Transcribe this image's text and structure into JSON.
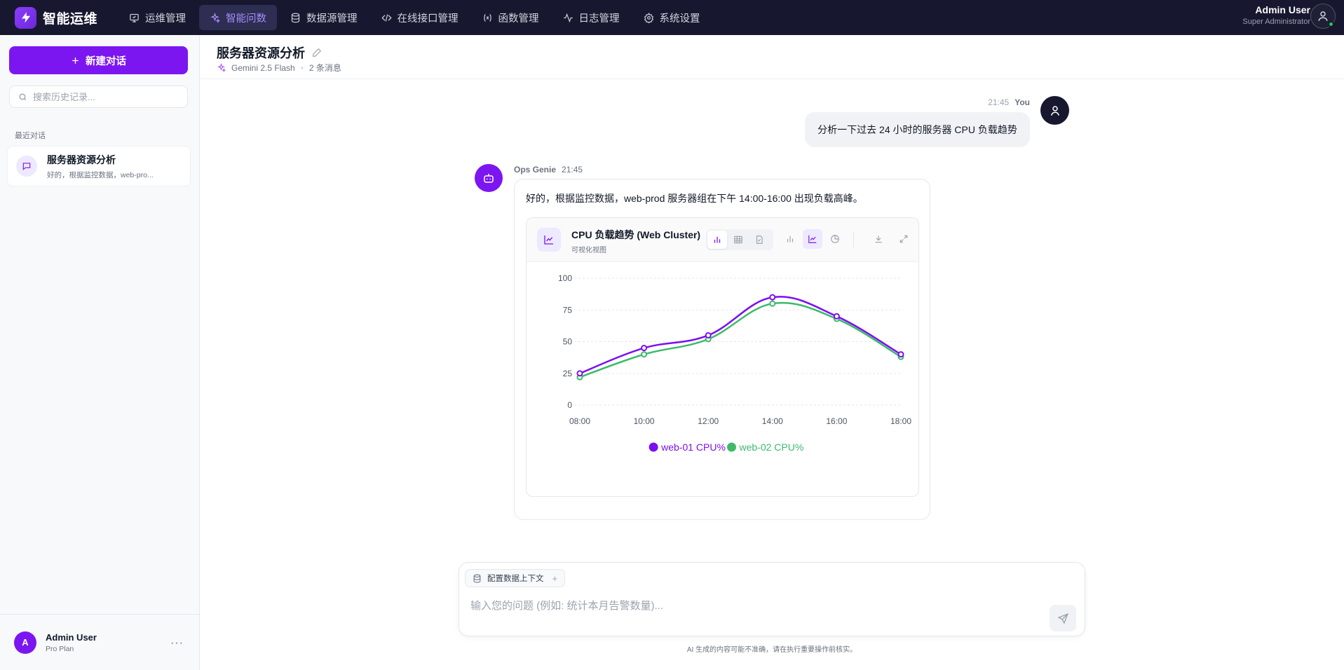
{
  "app": {
    "brand": "智能运维"
  },
  "nav": {
    "items": [
      {
        "label": "运维管理",
        "icon": "monitor-icon"
      },
      {
        "label": "智能问数",
        "icon": "sparkle-icon",
        "active": true
      },
      {
        "label": "数据源管理",
        "icon": "database-icon"
      },
      {
        "label": "在线接口管理",
        "icon": "code-icon"
      },
      {
        "label": "函数管理",
        "icon": "function-icon"
      },
      {
        "label": "日志管理",
        "icon": "activity-icon"
      },
      {
        "label": "系统设置",
        "icon": "gear-icon"
      }
    ]
  },
  "user": {
    "name": "Admin User",
    "role": "Super Administrator",
    "initial": "A",
    "plan": "Pro Plan"
  },
  "sidebar": {
    "new_chat": "新建对话",
    "search_placeholder": "搜索历史记录...",
    "section_label": "最近对话",
    "conversations": [
      {
        "title": "服务器资源分析",
        "preview": "好的，根据监控数据，web-pro..."
      }
    ]
  },
  "conversation": {
    "title": "服务器资源分析",
    "model": "Gemini 2.5 Flash",
    "message_count": "2 条消息"
  },
  "messages": {
    "user": {
      "time": "21:45",
      "sender": "You",
      "text": "分析一下过去 24 小时的服务器 CPU 负载趋势"
    },
    "bot": {
      "sender": "Ops Genie",
      "time": "21:45",
      "text": "好的，根据监控数据，web-prod 服务器组在下午 14:00-16:00 出现负载高峰。",
      "chart_title": "CPU 负载趋势 (Web Cluster)",
      "chart_subtitle": "可视化视图"
    }
  },
  "chart_data": {
    "type": "line",
    "categories": [
      "08:00",
      "10:00",
      "12:00",
      "14:00",
      "16:00",
      "18:00"
    ],
    "ylim": [
      0,
      100
    ],
    "yticks": [
      0,
      25,
      50,
      75,
      100
    ],
    "grid": true,
    "legend": "bottom",
    "series": [
      {
        "name": "web-01 CPU%",
        "color": "#7c0ff0",
        "values": [
          25,
          45,
          55,
          85,
          70,
          40
        ]
      },
      {
        "name": "web-02 CPU%",
        "color": "#3dba6a",
        "values": [
          22,
          40,
          52,
          80,
          68,
          38
        ]
      }
    ]
  },
  "composer": {
    "context_chip": "配置数据上下文",
    "placeholder": "输入您的问题 (例如: 统计本月告警数量)...",
    "disclaimer": "AI 生成的内容可能不准确，请在执行重要操作前核实。"
  },
  "colors": {
    "accent": "#7c16f0",
    "nav_bg": "#171830",
    "series1": "#7c0ff0",
    "series2": "#3dba6a"
  }
}
